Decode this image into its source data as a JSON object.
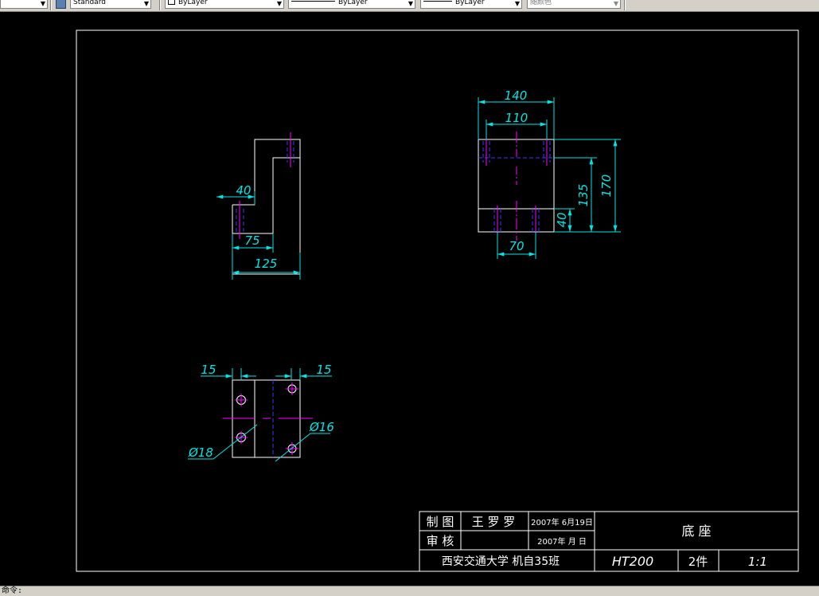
{
  "toolbar": {
    "text_style": "Standard",
    "layer_color": "ByLayer",
    "linetype": "ByLayer",
    "lineweight": "ByLayer",
    "plot_style": "随颜色"
  },
  "colors": {
    "background": "#000000",
    "geometry": "#ffffff",
    "dimension": "#00e5e5",
    "center": "#ff00ff",
    "hidden": "#3a3aff"
  },
  "dims": {
    "d140": "140",
    "d110": "110",
    "d170": "170",
    "d135": "135",
    "d40_top": "40",
    "d70": "70",
    "d40_side": "40",
    "d75": "75",
    "d125": "125",
    "d15_left": "15",
    "d15_right": "15",
    "phi18": "Ø18",
    "phi16": "Ø16"
  },
  "title_block": {
    "drawn_label": "制 图",
    "drawn_by": "王 罗 罗",
    "drawn_date": "2007年 6月19日",
    "check_label": "审 核",
    "check_date": "2007年   月   日",
    "school": "西安交通大学  机自35班",
    "part_name": "底 座",
    "material": "HT200",
    "quantity": "2件",
    "scale": "1:1"
  },
  "command": {
    "prompt": "命令:"
  }
}
